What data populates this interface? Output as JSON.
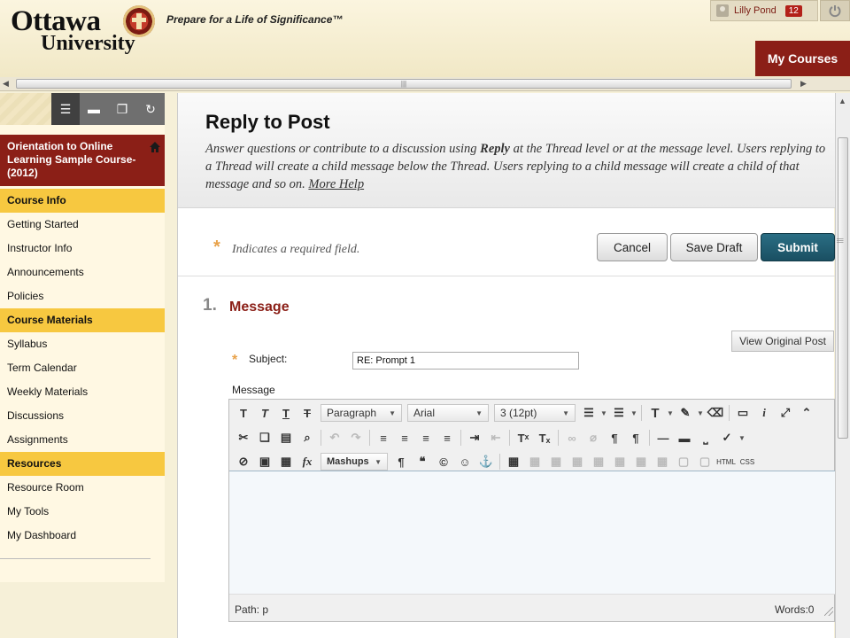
{
  "header": {
    "logo_line1": "Ottawa",
    "logo_line2": "University",
    "tagline": "Prepare for a Life of Significance™",
    "user_name": "Lilly Pond",
    "notification_count": "12",
    "my_courses_label": "My Courses"
  },
  "sidebar": {
    "course_title": "Orientation to Online Learning Sample Course-(2012)",
    "items": [
      {
        "label": "Course Info",
        "section": true
      },
      {
        "label": "Getting Started",
        "section": false
      },
      {
        "label": "Instructor Info",
        "section": false
      },
      {
        "label": "Announcements",
        "section": false
      },
      {
        "label": "Policies",
        "section": false
      },
      {
        "label": "Course Materials",
        "section": true
      },
      {
        "label": "Syllabus",
        "section": false
      },
      {
        "label": "Term Calendar",
        "section": false
      },
      {
        "label": "Weekly Materials",
        "section": false
      },
      {
        "label": "Discussions",
        "section": false
      },
      {
        "label": "Assignments",
        "section": false
      },
      {
        "label": "Resources",
        "section": true
      },
      {
        "label": "Resource Room",
        "section": false
      },
      {
        "label": "My Tools",
        "section": false
      },
      {
        "label": "My Dashboard",
        "section": false
      }
    ]
  },
  "page": {
    "title": "Reply to Post",
    "desc_part1": "Answer questions or contribute to a discussion using ",
    "desc_bold": "Reply",
    "desc_part2": " at the Thread level or at the message level. Users replying to a Thread will create a child message below the Thread. Users replying to a child message will create a child of that message and so on. ",
    "more_help": "More Help",
    "required_note": "Indicates a required field.",
    "required_star": "*",
    "buttons": {
      "cancel": "Cancel",
      "save_draft": "Save Draft",
      "submit": "Submit"
    },
    "section_number": "1.",
    "section_title": "Message",
    "view_original": "View Original Post",
    "subject_label": "Subject:",
    "subject_value": "RE: Prompt 1",
    "message_label": "Message"
  },
  "editor": {
    "format_select": "Paragraph",
    "font_select": "Arial",
    "size_select": "3 (12pt)",
    "mashups_label": "Mashups",
    "html_label": "HTML",
    "css_label": "CSS",
    "path_text": "Path: p",
    "words_text": "Words:0"
  }
}
